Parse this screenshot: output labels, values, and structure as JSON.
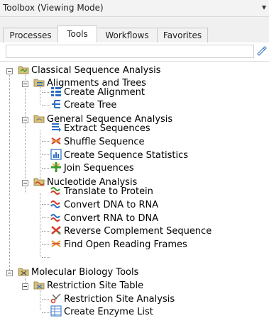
{
  "panel": {
    "title": "Toolbox (Viewing Mode)",
    "pin_icon": "pin-icon",
    "tabs": [
      "Processes",
      "Tools",
      "Workflows",
      "Favorites"
    ],
    "active_tab": "Tools",
    "search": {
      "value": "",
      "placeholder": "",
      "icon": "search-icon"
    }
  },
  "tree": {
    "root": {
      "label": "Classical Sequence Analysis",
      "groups": [
        {
          "label": "Alignments and Trees",
          "items": [
            "Create Alignment",
            "Create Tree"
          ]
        },
        {
          "label": "General Sequence Analysis",
          "items": [
            "Extract Sequences",
            "Shuffle Sequence",
            "Create Sequence Statistics",
            "Join Sequences"
          ]
        },
        {
          "label": "Nucleotide Analysis",
          "items": [
            "Translate to Protein",
            "Convert DNA to RNA",
            "Convert RNA to DNA",
            "Reverse Complement Sequence",
            "Find Open Reading Frames"
          ]
        }
      ]
    },
    "molecular": {
      "label": "Molecular Biology Tools",
      "groups": [
        {
          "label": "Restriction Site Table",
          "items": [
            "Restriction Site Analysis",
            "Create Enzyme List"
          ]
        }
      ]
    }
  },
  "colors": {
    "accent": "#2b6cc4",
    "red": "#d23a2a",
    "green": "#3c9a2e"
  }
}
